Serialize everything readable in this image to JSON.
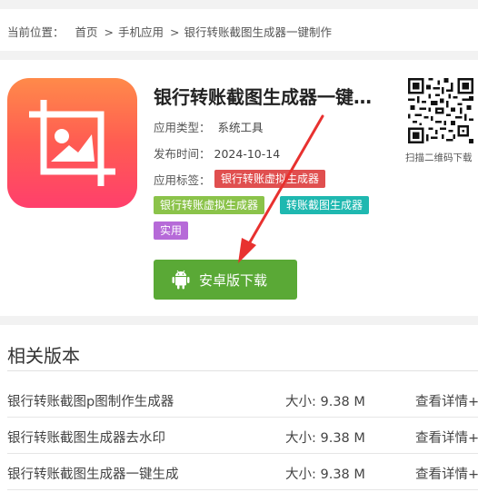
{
  "breadcrumb": {
    "label": "当前位置：",
    "items": [
      "首页",
      "手机应用",
      "银行转账截图生成器一键制作"
    ],
    "separator": ">"
  },
  "app": {
    "title": "银行转账截图生成器一键…",
    "type_label": "应用类型：",
    "type_value": "系统工具",
    "date_label": "发布时间：",
    "date_value": "2024-10-14",
    "tags_label": "应用标签：",
    "tags": [
      "银行转账虚拟生成器",
      "银行转账虚拟生成器",
      "转账截图生成器",
      "实用"
    ],
    "download_label": "安卓版下载",
    "qr_caption": "扫描二维码下载",
    "icon": "image-crop-icon"
  },
  "colors": {
    "accent_green": "#5aa936",
    "tag_red": "#e04f4f",
    "tag_green": "#8bc34a",
    "tag_teal": "#1fb8b0",
    "tag_purple": "#b66ad8",
    "arrow_red": "#e8312f"
  },
  "related": {
    "title": "相关版本",
    "size_label": "大小:",
    "rows": [
      {
        "name": "银行转账截图p图制作生成器",
        "size": "9.38 M",
        "detail": "查看详情+"
      },
      {
        "name": "银行转账截图生成器去水印",
        "size": "9.38 M",
        "detail": "查看详情+"
      },
      {
        "name": "银行转账截图生成器一键生成",
        "size": "9.38 M",
        "detail": "查看详情+"
      }
    ]
  }
}
